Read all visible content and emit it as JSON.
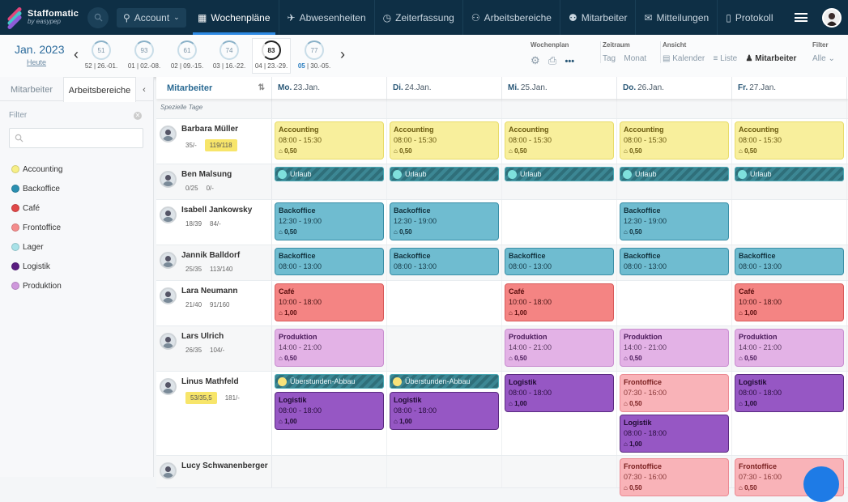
{
  "app": {
    "name": "Staffomatic",
    "tagline": "by easypep"
  },
  "nav": {
    "account_label": "Account",
    "items": [
      {
        "label": "Wochenpläne",
        "icon": "calendar-icon",
        "active": true
      },
      {
        "label": "Abwesenheiten",
        "icon": "plane-icon",
        "active": false
      },
      {
        "label": "Zeiterfassung",
        "icon": "clock-icon",
        "active": false
      },
      {
        "label": "Arbeitsbereiche",
        "icon": "org-icon",
        "active": false
      },
      {
        "label": "Mitarbeiter",
        "icon": "users-icon",
        "active": false
      },
      {
        "label": "Mitteilungen",
        "icon": "mail-icon",
        "active": false
      },
      {
        "label": "Protokoll",
        "icon": "clipboard-icon",
        "active": false
      }
    ]
  },
  "subbar": {
    "month": "Jan. 2023",
    "today": "Heute",
    "weeks": [
      {
        "score": "51",
        "num": "52",
        "range": "26.-01."
      },
      {
        "score": "93",
        "num": "01",
        "range": "02.-08."
      },
      {
        "score": "61",
        "num": "02",
        "range": "09.-15."
      },
      {
        "score": "74",
        "num": "03",
        "range": "16.-22."
      },
      {
        "score": "83",
        "num": "04",
        "range": "23.-29.",
        "current": true
      },
      {
        "score": "77",
        "num": "05",
        "range": "30.-05."
      }
    ],
    "wochenplan_label": "Wochenplan",
    "zeitraum_label": "Zeitraum",
    "zeitraum_options": [
      "Tag",
      "Monat"
    ],
    "ansicht_label": "Ansicht",
    "ansicht_options": [
      "Kalender",
      "Liste",
      "Mitarbeiter"
    ],
    "filter_label": "Filter",
    "filter_value": "Alle"
  },
  "sidebar": {
    "tabs": [
      "Mitarbeiter",
      "Arbeitsbereiche"
    ],
    "filter_label": "Filter",
    "search_placeholder": "",
    "areas": [
      {
        "name": "Accounting",
        "color": "#f7ef86"
      },
      {
        "name": "Backoffice",
        "color": "#2a8fb0"
      },
      {
        "name": "Café",
        "color": "#e04848"
      },
      {
        "name": "Frontoffice",
        "color": "#f48c8c"
      },
      {
        "name": "Lager",
        "color": "#a8e2e8"
      },
      {
        "name": "Logistik",
        "color": "#5a1d80"
      },
      {
        "name": "Produktion",
        "color": "#cf98dc"
      }
    ]
  },
  "grid": {
    "employee_header": "Mitarbeiter",
    "days": [
      {
        "dow": "Mo.",
        "date": "23.Jan."
      },
      {
        "dow": "Di.",
        "date": "24.Jan."
      },
      {
        "dow": "Mi.",
        "date": "25.Jan."
      },
      {
        "dow": "Do.",
        "date": "26.Jan."
      },
      {
        "dow": "Fr.",
        "date": "27.Jan."
      }
    ],
    "special_days_label": "Spezielle Tage",
    "employees": [
      {
        "name": "Barbara Müller",
        "s1": "35/-",
        "s2": "119/118",
        "hl": "s2"
      },
      {
        "name": "Ben Malsung",
        "s1": "0/25",
        "s2": "0/-"
      },
      {
        "name": "Isabell Jankowsky",
        "s1": "18/39",
        "s2": "84/-"
      },
      {
        "name": "Jannik Balldorf",
        "s1": "25/35",
        "s2": "113/140"
      },
      {
        "name": "Lara Neumann",
        "s1": "21/40",
        "s2": "91/160"
      },
      {
        "name": "Lars Ulrich",
        "s1": "26/35",
        "s2": "104/-"
      },
      {
        "name": "Linus Mathfeld",
        "s1": "53/35,5",
        "s2": "181/-",
        "hl": "s1"
      },
      {
        "name": "Lucy Schwanenberger",
        "s1": "",
        "s2": ""
      }
    ],
    "shifts": {
      "accounting": {
        "title": "Accounting",
        "time": "08:00 - 15:30",
        "weight": "0,50"
      },
      "urlaub": {
        "title": "Urlaub"
      },
      "backoffice_late": {
        "title": "Backoffice",
        "time": "12:30 - 19:00",
        "weight": "0,50"
      },
      "backoffice_early": {
        "title": "Backoffice",
        "time": "08:00 - 13:00"
      },
      "cafe": {
        "title": "Café",
        "time": "10:00 - 18:00",
        "weight": "1,00"
      },
      "produktion": {
        "title": "Produktion",
        "time": "14:00 - 21:00",
        "weight": "0,50"
      },
      "ueberstunden": {
        "title": "Überstunden-Abbau"
      },
      "logistik": {
        "title": "Logistik",
        "time": "08:00 - 18:00",
        "weight": "1,00"
      },
      "frontoffice": {
        "title": "Frontoffice",
        "time": "07:30 - 16:00",
        "weight": "0,50"
      }
    }
  }
}
